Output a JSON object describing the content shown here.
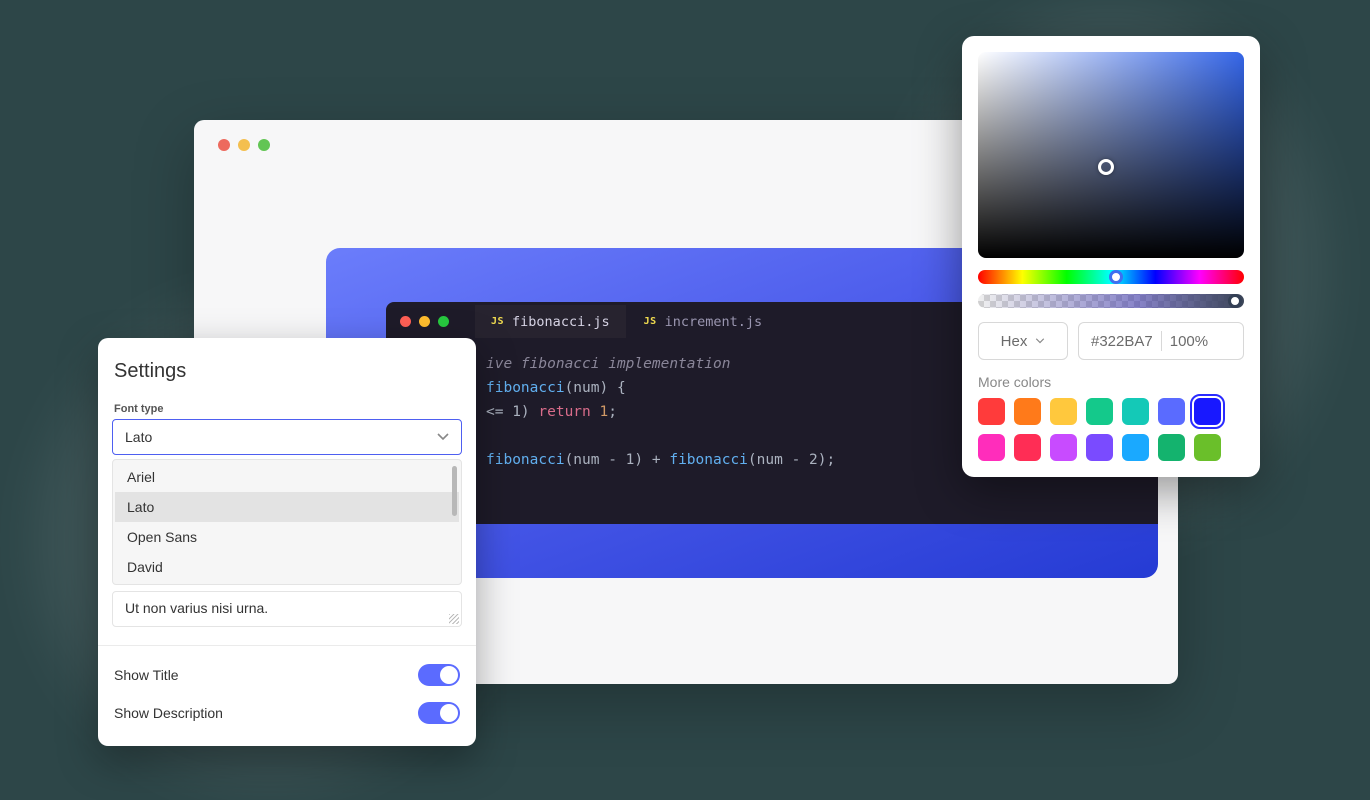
{
  "browser": {
    "traffic_lights": [
      "close",
      "minimize",
      "zoom"
    ]
  },
  "editor": {
    "tabs": [
      {
        "badge": "JS",
        "label": "fibonacci.js",
        "active": true
      },
      {
        "badge": "JS",
        "label": "increment.js",
        "active": false
      }
    ],
    "code_lines": [
      {
        "kind": "comment",
        "text": "ive fibonacci implementation"
      },
      {
        "kind": "sig",
        "name": "fibonacci",
        "rest": "(num) {"
      },
      {
        "kind": "cond",
        "lhs": "&lt;= 1) ",
        "kw": "return",
        "num": " 1",
        "tail": ";"
      },
      {
        "kind": "blank"
      },
      {
        "kind": "ret",
        "a": "fibonacci",
        "b": "(num - 1) + ",
        "c": "fibonacci",
        "d": "(num - 2);"
      }
    ]
  },
  "settings": {
    "title": "Settings",
    "font_type_label": "Font type",
    "font_type_value": "Lato",
    "font_options": [
      "Ariel",
      "Lato",
      "Open Sans",
      "David"
    ],
    "font_selected_index": 1,
    "textarea_value": "Ut non varius nisi urna.",
    "toggles": [
      {
        "label": "Show Title",
        "on": true
      },
      {
        "label": "Show Description",
        "on": true
      }
    ]
  },
  "picker": {
    "format_label": "Hex",
    "hex": "#322BA7",
    "alpha": "100%",
    "more_label": "More colors",
    "swatches_row1": [
      "#ff3b3b",
      "#ff7a1a",
      "#ffc83d",
      "#14c98b",
      "#14c9b7",
      "#5a6bff",
      "#1818ff"
    ],
    "swatches_row2": [
      "#ff2dbb",
      "#ff2d55",
      "#c84bff",
      "#7a4bff",
      "#1aa9ff",
      "#14b36e",
      "#6abf2a"
    ],
    "selected_swatch_index": 6
  }
}
